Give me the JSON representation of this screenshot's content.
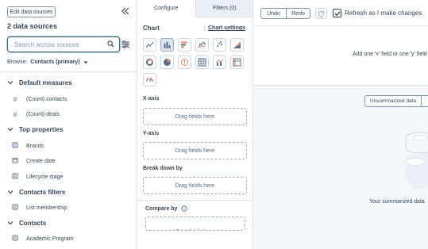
{
  "left": {
    "edit_button": "Edit data sources",
    "source_count": "2 data sources",
    "search_placeholder": "Search across sources",
    "browse_label": "Browse:",
    "browse_value": "Contacts (primary)",
    "groups": [
      {
        "label": "Default measures",
        "items": [
          {
            "label": "(Count) contacts",
            "icon": "hash-icon"
          },
          {
            "label": "(Count) deals",
            "icon": "hash-icon"
          }
        ]
      },
      {
        "label": "Top properties",
        "items": [
          {
            "label": "Brands",
            "icon": "property-icon"
          },
          {
            "label": "Create date",
            "icon": "calendar-icon"
          },
          {
            "label": "Lifecycle stage",
            "icon": "property-icon"
          }
        ]
      },
      {
        "label": "Contacts filters",
        "items": [
          {
            "label": "List membership",
            "icon": "property-icon"
          }
        ]
      },
      {
        "label": "Contacts",
        "items": [
          {
            "label": "Academic Program",
            "icon": "property-icon"
          }
        ]
      }
    ]
  },
  "middle": {
    "tabs": [
      {
        "label": "Configure",
        "active": true
      },
      {
        "label": "Filters (0)",
        "active": false
      }
    ],
    "chart_heading": "Chart",
    "chart_settings": "Chart settings",
    "chart_types": [
      "line-chart-icon",
      "bar-chart-icon",
      "horizontal-bar-icon",
      "area-chart-icon",
      "scatter-chart-icon",
      "stacked-bar-icon",
      "donut-chart-icon",
      "pie-chart-icon",
      "kpi-icon",
      "table-icon",
      "combo-chart-icon",
      "pivot-table-icon",
      "gauge-icon"
    ],
    "selected_chart_type": "bar-chart-icon",
    "xaxis_label": "X-axis",
    "yaxis_label": "Y-axis",
    "breakdown_label": "Break down by",
    "compare_label": "Compare by",
    "drop_text": "Drag fields here"
  },
  "right": {
    "undo": "Undo",
    "redo": "Redo",
    "refresh_label": "Refresh as I make changes",
    "refresh_checked": true,
    "hint": "Add one 'x' field or one 'y' field",
    "unsummarized_button": "Unsummarized data",
    "summarized_text": "Your summarized data"
  },
  "colors": {
    "text": "#33475b",
    "border": "#dfe3eb",
    "panel_bg": "#f5f8fa",
    "accent_focus": "#9fd7e8"
  }
}
